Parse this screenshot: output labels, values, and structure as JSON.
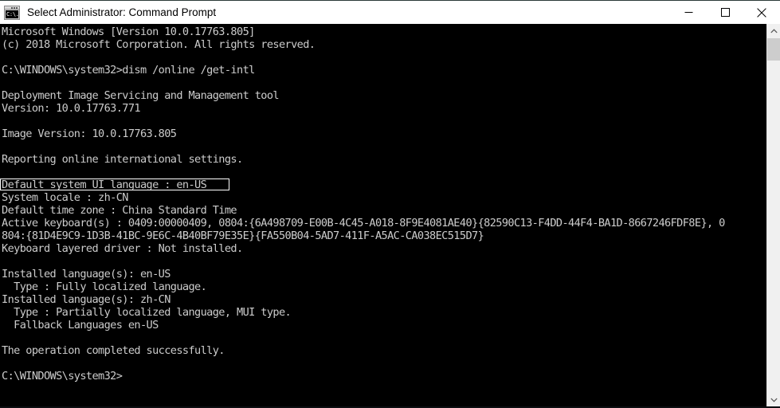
{
  "window": {
    "title": "Select Administrator: Command Prompt",
    "icon_name": "command-prompt-icon",
    "icon_glyph_line1": "C:\\.",
    "colors": {
      "titlebar_bg": "#ffffff",
      "titlebar_text": "#000000",
      "console_bg": "#000000",
      "console_text": "#cccccc",
      "scrollbar_track": "#f0f0f0",
      "scrollbar_thumb": "#cdcdcd",
      "selection_outline": "#ffffff"
    },
    "controls": {
      "minimize_label": "Minimize",
      "maximize_label": "Maximize",
      "close_label": "Close"
    }
  },
  "scrollbar": {
    "up_arrow_label": "Scroll up",
    "down_arrow_label": "Scroll down",
    "thumb_label": "Scroll thumb"
  },
  "console": {
    "lines": [
      "Microsoft Windows [Version 10.0.17763.805]",
      "(c) 2018 Microsoft Corporation. All rights reserved.",
      "",
      "C:\\WINDOWS\\system32>dism /online /get-intl",
      "",
      "Deployment Image Servicing and Management tool",
      "Version: 10.0.17763.771",
      "",
      "Image Version: 10.0.17763.805",
      "",
      "Reporting online international settings.",
      "",
      "Default system UI language : en-US",
      "System locale : zh-CN",
      "Default time zone : China Standard Time",
      "Active keyboard(s) : 0409:00000409, 0804:{6A498709-E00B-4C45-A018-8F9E4081AE40}{82590C13-F4DD-44F4-BA1D-8667246FDF8E}, 0",
      "804:{81D4E9C9-1D3B-41BC-9E6C-4B40BF79E35E}{FA550B04-5AD7-411F-A5AC-CA038EC515D7}",
      "Keyboard layered driver : Not installed.",
      "",
      "Installed language(s): en-US",
      "  Type : Fully localized language.",
      "Installed language(s): zh-CN",
      "  Type : Partially localized language, MUI type.",
      "  Fallback Languages en-US",
      "",
      "The operation completed successfully.",
      "",
      "C:\\WINDOWS\\system32>"
    ],
    "selected_line_index": 12,
    "selected_line_text": "Default system UI language : en-US"
  }
}
